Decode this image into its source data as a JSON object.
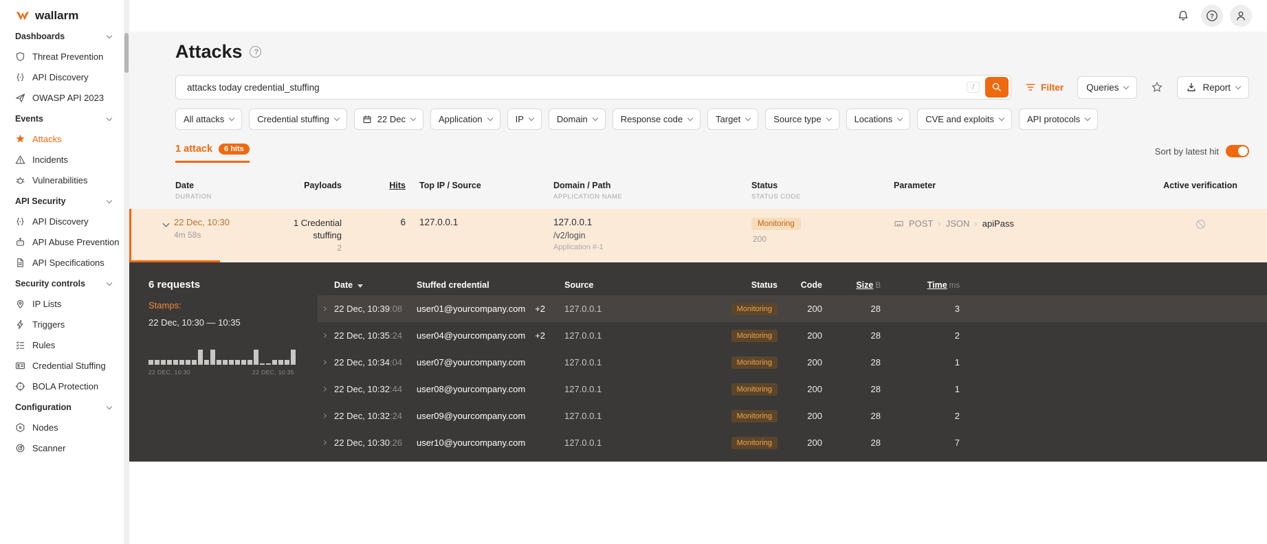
{
  "colors": {
    "accent": "#f0690f",
    "dark_panel": "#3b3937",
    "row_highlight": "#fcead9",
    "monitoring_badge_text": "#bf6517"
  },
  "sidebar": {
    "logo_text": "wallarm",
    "sections": [
      {
        "label": "Dashboards",
        "items": [
          {
            "label": "Threat Prevention"
          },
          {
            "label": "API Discovery"
          },
          {
            "label": "OWASP API 2023"
          }
        ]
      },
      {
        "label": "Events",
        "items": [
          {
            "label": "Attacks",
            "active": true
          },
          {
            "label": "Incidents"
          },
          {
            "label": "Vulnerabilities"
          }
        ]
      },
      {
        "label": "API Security",
        "items": [
          {
            "label": "API Discovery"
          },
          {
            "label": "API Abuse Prevention"
          },
          {
            "label": "API Specifications"
          }
        ]
      },
      {
        "label": "Security controls",
        "items": [
          {
            "label": "IP Lists"
          },
          {
            "label": "Triggers"
          },
          {
            "label": "Rules"
          },
          {
            "label": "Credential Stuffing"
          },
          {
            "label": "BOLA Protection"
          }
        ]
      },
      {
        "label": "Configuration",
        "items": [
          {
            "label": "Nodes"
          },
          {
            "label": "Scanner"
          }
        ]
      }
    ]
  },
  "page": {
    "title": "Attacks",
    "search": {
      "value": "attacks today credential_stuffing",
      "shortcut_key": "/"
    },
    "toolbar": {
      "filter_label": "Filter",
      "queries_label": "Queries",
      "report_label": "Report"
    },
    "filter_chips": [
      "All attacks",
      "Credential stuffing",
      "22 Dec",
      "Application",
      "IP",
      "Domain",
      "Response code",
      "Target",
      "Source type",
      "Locations",
      "CVE and exploits",
      "API protocols"
    ],
    "tab": {
      "label": "1 attack",
      "hits_badge": "6 hits"
    },
    "sort_label": "Sort by latest hit",
    "sort_toggle_on": true
  },
  "attack_table": {
    "headers": {
      "date": "Date",
      "date_sub": "DURATION",
      "payloads": "Payloads",
      "hits": "Hits",
      "top_ip": "Top IP / Source",
      "domain": "Domain / Path",
      "domain_sub": "APPLICATION NAME",
      "status": "Status",
      "status_sub": "STATUS CODE",
      "parameter": "Parameter",
      "verification": "Active verification"
    },
    "row": {
      "date": "22 Dec, 10:30",
      "duration": "4m 58s",
      "payload": "1 Credential stuffing",
      "payload_count": "2",
      "hits": "6",
      "top_ip": "127.0.0.1",
      "domain": "127.0.0.1",
      "path": "/v2/login",
      "application": "Application #-1",
      "status": "Monitoring",
      "status_code": "200",
      "parameter": {
        "method": "POST",
        "sep1": "›",
        "format": "JSON",
        "sep2": "›",
        "name": "apiPass"
      }
    }
  },
  "details": {
    "requests_label": "6 requests",
    "stamps_label": "Stamps:",
    "stamps_range": "22 Dec, 10:30 — 10:35",
    "histogram": {
      "values": [
        1,
        1,
        1,
        1,
        1,
        1,
        1,
        1,
        3,
        1,
        3,
        1,
        1,
        1,
        1,
        1,
        1,
        3,
        0,
        0,
        1,
        1,
        1,
        3
      ],
      "axis_start": "22 DEC, 10:30",
      "axis_end": "22 DEC, 10:35"
    },
    "headers": {
      "date": "Date",
      "credential": "Stuffed credential",
      "source": "Source",
      "status": "Status",
      "code": "Code",
      "size": "Size",
      "size_unit": "B",
      "time": "Time",
      "time_unit": "ms"
    },
    "rows": [
      {
        "date": "22 Dec, 10:39",
        "seconds": ":08",
        "credential": "user01@yourcompany.com",
        "extra": "+2",
        "source": "127.0.0.1",
        "status": "Monitoring",
        "code": "200",
        "size": "28",
        "time": "3"
      },
      {
        "date": "22 Dec, 10:35",
        "seconds": ":24",
        "credential": "user04@yourcompany.com",
        "extra": "+2",
        "source": "127.0.0.1",
        "status": "Monitoring",
        "code": "200",
        "size": "28",
        "time": "2"
      },
      {
        "date": "22 Dec, 10:34",
        "seconds": ":04",
        "credential": "user07@yourcompany.com",
        "source": "127.0.0.1",
        "status": "Monitoring",
        "code": "200",
        "size": "28",
        "time": "1"
      },
      {
        "date": "22 Dec, 10:32",
        "seconds": ":44",
        "credential": "user08@yourcompany.com",
        "source": "127.0.0.1",
        "status": "Monitoring",
        "code": "200",
        "size": "28",
        "time": "1"
      },
      {
        "date": "22 Dec, 10:32",
        "seconds": ":24",
        "credential": "user09@yourcompany.com",
        "source": "127.0.0.1",
        "status": "Monitoring",
        "code": "200",
        "size": "28",
        "time": "2"
      },
      {
        "date": "22 Dec, 10:30",
        "seconds": ":26",
        "credential": "user10@yourcompany.com",
        "source": "127.0.0.1",
        "status": "Monitoring",
        "code": "200",
        "size": "28",
        "time": "7"
      }
    ]
  }
}
